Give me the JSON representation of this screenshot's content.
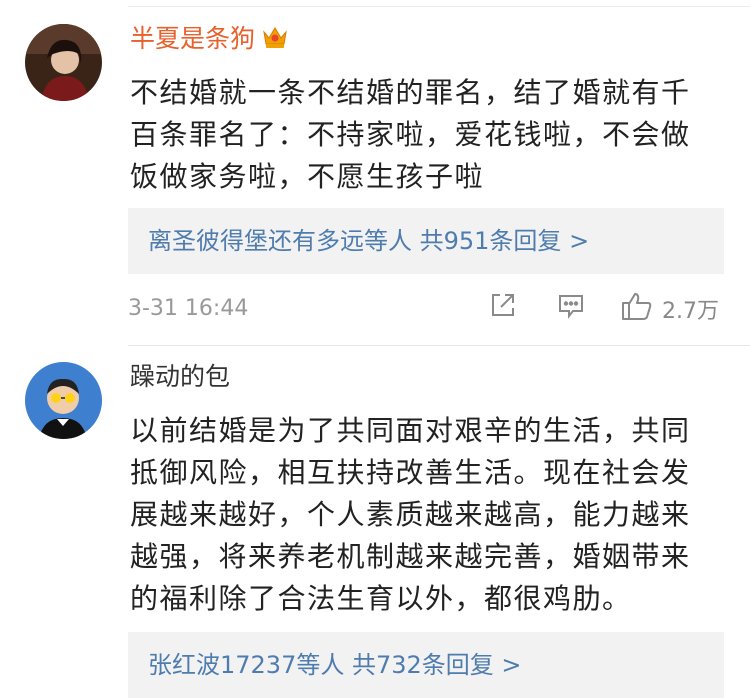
{
  "comments": [
    {
      "username": "半夏是条狗",
      "badge_icon": "crown-vip-icon",
      "text": "不结婚就一条不结婚的罪名，结了婚就有千\n百条罪名了：不持家啦，爱花钱啦，不会做\n饭做家务啦，不愿生孩子啦",
      "reply_summary": "离圣彼得堡还有多远等人  共951条回复 >",
      "time": "3-31 16:44",
      "like_count": "2.7万",
      "colors": {
        "username": "#e8612c",
        "reply_link": "#4f7cae"
      }
    },
    {
      "username": "躁动的包",
      "text": "以前结婚是为了共同面对艰辛的生活，共同\n抵御风险，相互扶持改善生活。现在社会发\n展越来越好，个人素质越来越高，能力越来\n越强，将来养老机制越来越完善，婚姻带来\n的福利除了合法生育以外，都很鸡肋。",
      "reply_summary": "张红波17237等人  共732条回复 >"
    }
  ]
}
